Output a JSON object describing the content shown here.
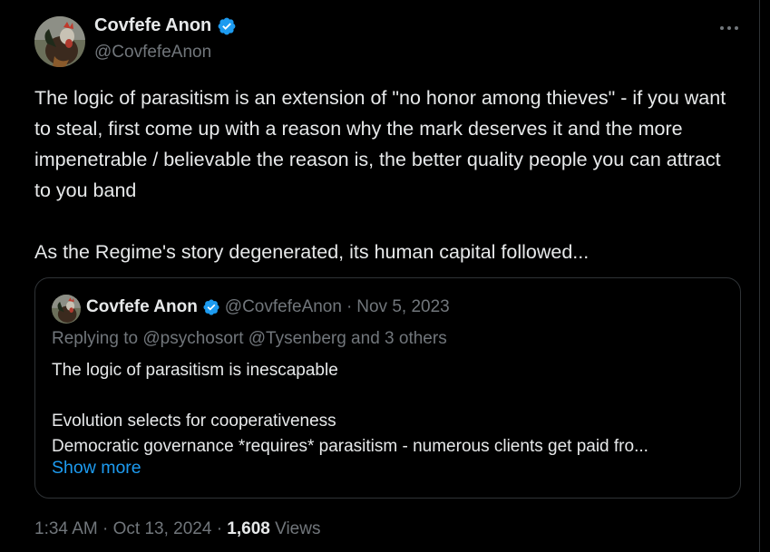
{
  "tweet": {
    "author_name": "Covfefe Anon",
    "author_handle": "@CovfefeAnon",
    "text": "The logic of parasitism is an extension of \"no honor among thieves\" - if you want to steal, first come up with a reason why the mark deserves it and the more impenetrable / believable the reason is, the better quality people you can attract to you band\n\nAs the Regime's story degenerated, its human capital followed...",
    "time": "1:34 AM",
    "separator": "·",
    "date": "Oct 13, 2024",
    "views_count": "1,608",
    "views_label": "Views"
  },
  "quote": {
    "author_name": "Covfefe Anon",
    "author_handle": "@CovfefeAnon",
    "separator": "·",
    "date": "Nov 5, 2023",
    "replying_to": "Replying to @psychosort @Tysenberg and 3 others",
    "lines": [
      "The logic of parasitism is inescapable",
      "",
      "Evolution selects for cooperativeness",
      "Democratic governance *requires* parasitism - numerous clients get paid fro..."
    ],
    "show_more": "Show more"
  },
  "icons": {
    "verified": "verified-badge-icon",
    "more": "more-horizontal-icon"
  },
  "colors": {
    "background": "#000000",
    "text": "#e7e9ea",
    "secondary": "#71767b",
    "accent": "#1d9bf0",
    "border": "#2f3336"
  }
}
